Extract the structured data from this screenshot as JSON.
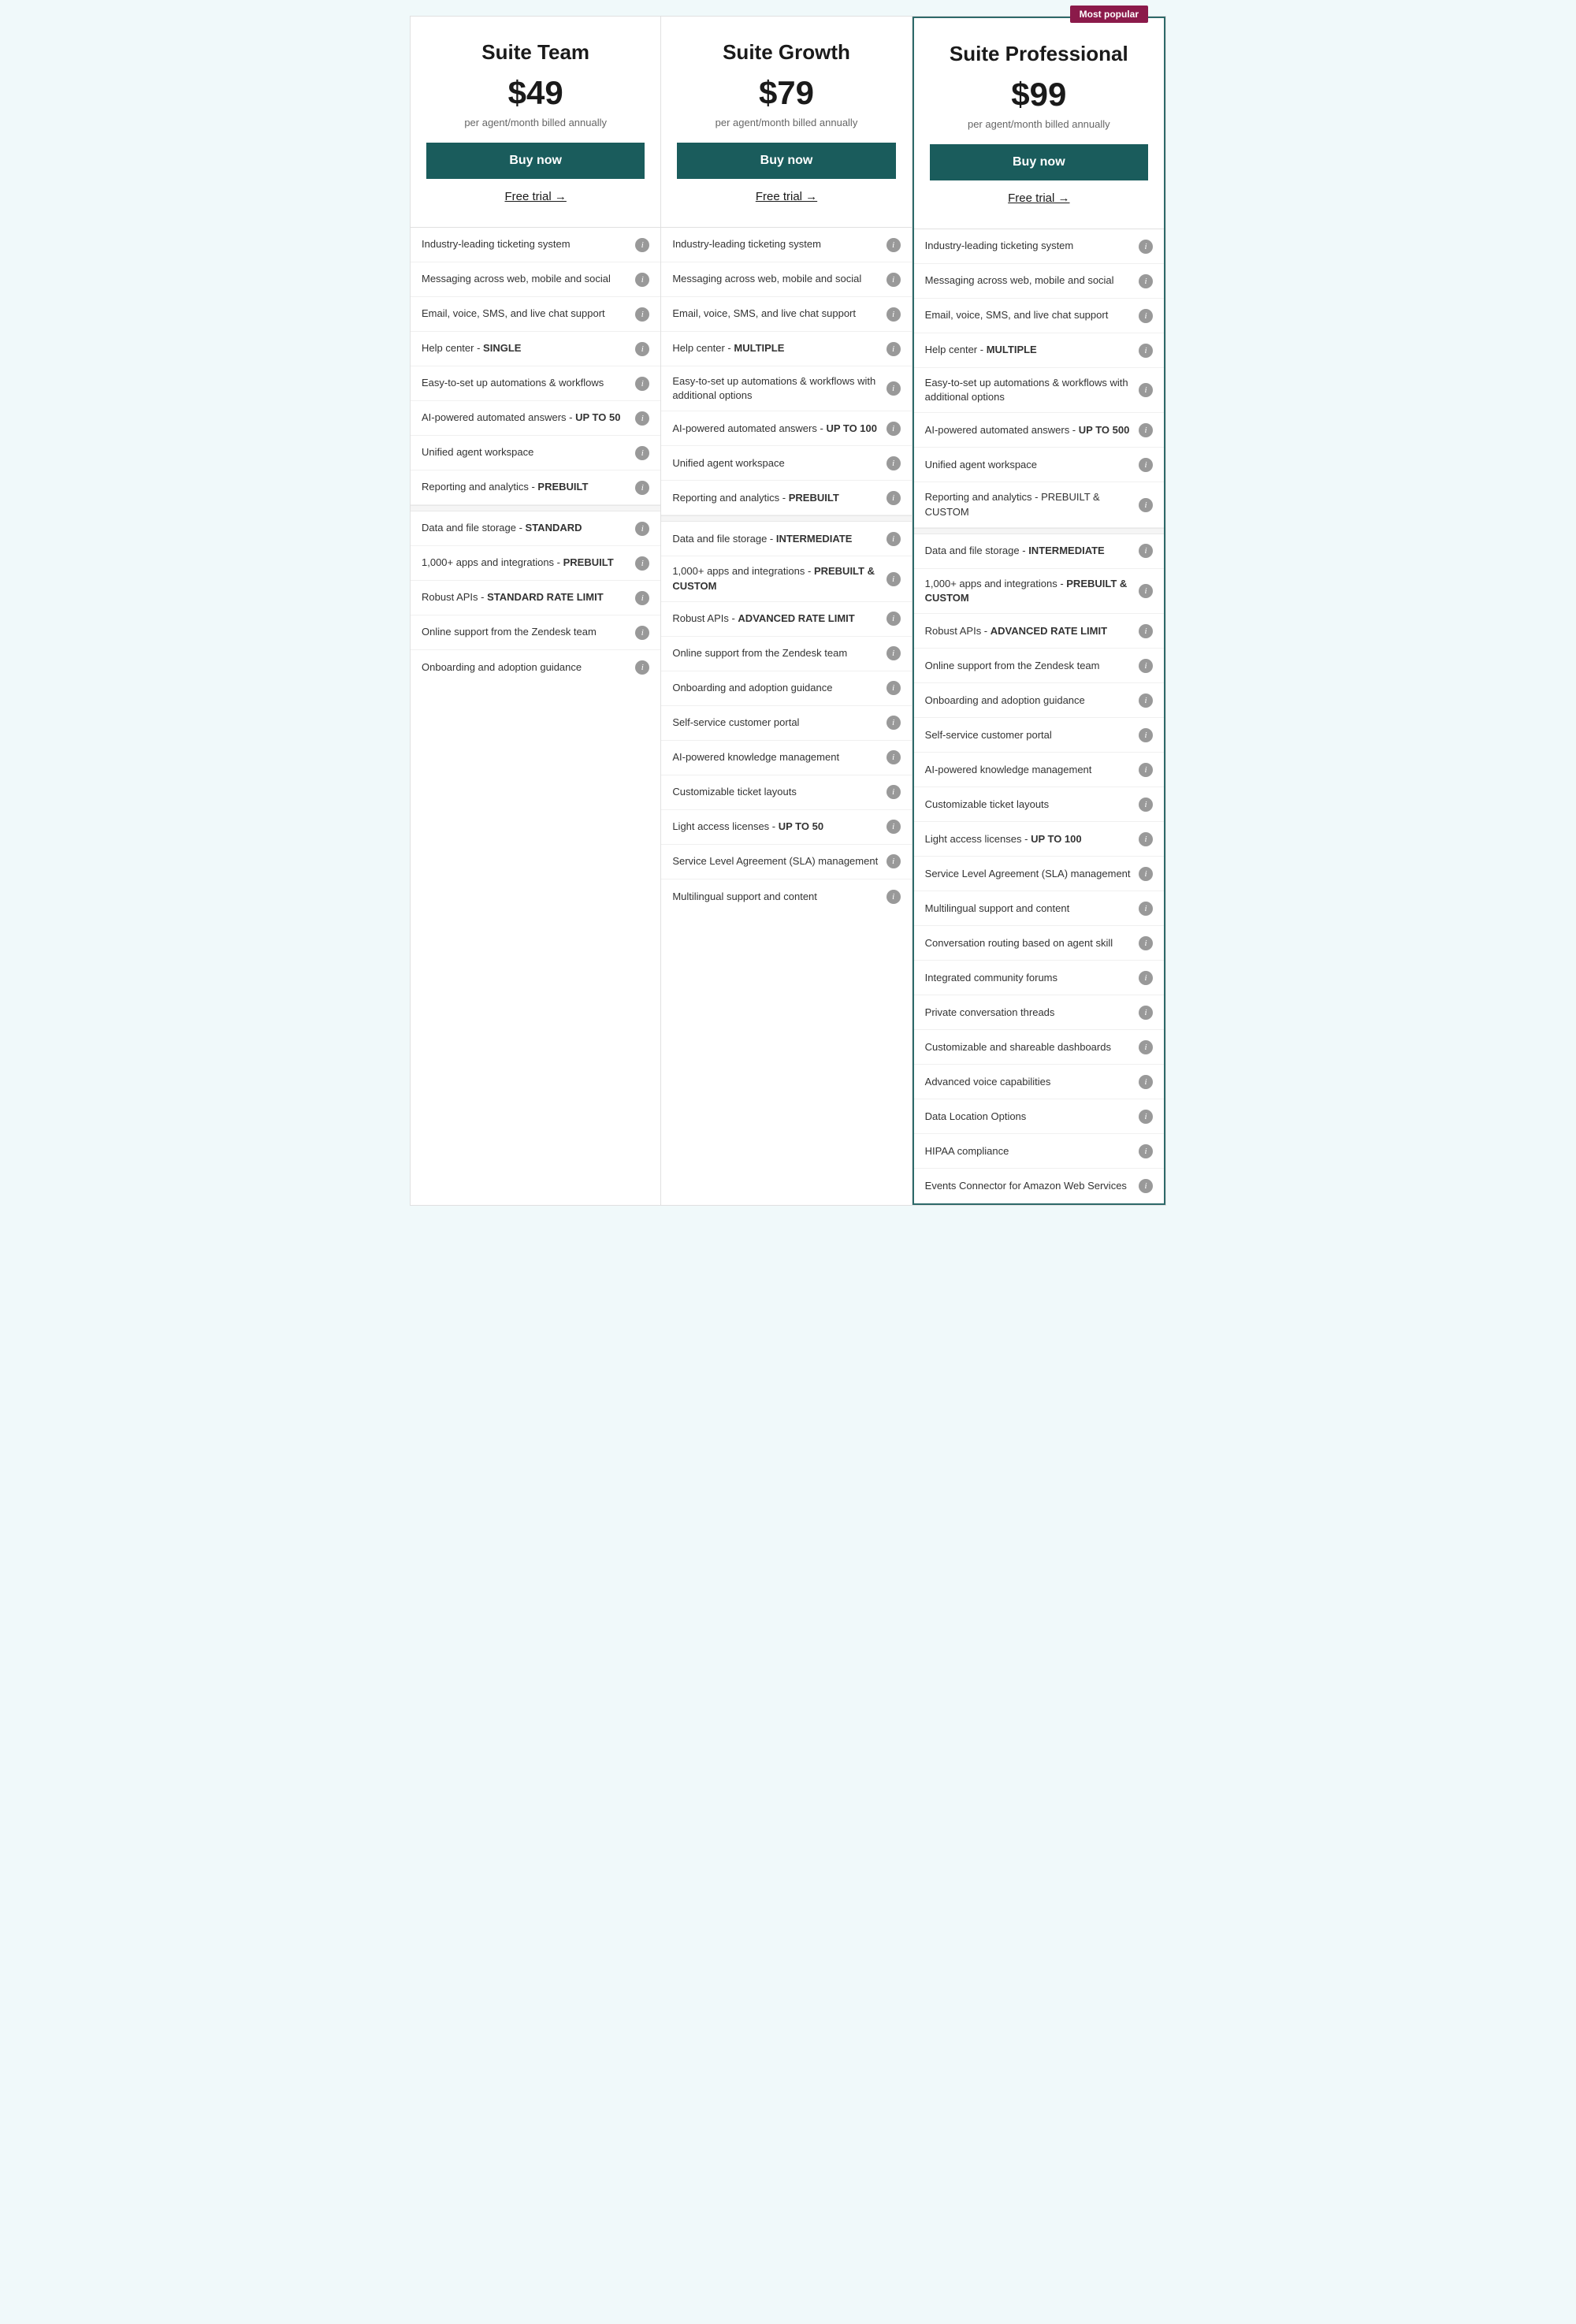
{
  "plans": [
    {
      "id": "suite-team",
      "name": "Suite Team",
      "price": "$49",
      "billing": "per agent/month billed annually",
      "buy_label": "Buy now",
      "free_trial_label": "Free trial →",
      "most_popular": false,
      "features": [
        {
          "text": "Industry-leading ticketing system",
          "bold": ""
        },
        {
          "text": "Messaging across web, mobile and social",
          "bold": ""
        },
        {
          "text": "Email, voice, SMS, and live chat support",
          "bold": ""
        },
        {
          "text": "Help center - ",
          "bold": "SINGLE"
        },
        {
          "text": "Easy-to-set up automations & workflows",
          "bold": ""
        },
        {
          "text": "AI-powered automated answers - ",
          "bold": "UP TO 50"
        },
        {
          "text": "Unified agent workspace",
          "bold": ""
        },
        {
          "text": "Reporting and analytics - ",
          "bold": "PREBUILT"
        },
        {
          "text": "DIVIDER",
          "bold": ""
        },
        {
          "text": "Data and file storage - ",
          "bold": "STANDARD"
        },
        {
          "text": "1,000+ apps and integrations - ",
          "bold": "PREBUILT"
        },
        {
          "text": "Robust APIs - ",
          "bold": "STANDARD RATE LIMIT"
        },
        {
          "text": "Online support from the Zendesk team",
          "bold": ""
        },
        {
          "text": "Onboarding and adoption guidance",
          "bold": ""
        }
      ]
    },
    {
      "id": "suite-growth",
      "name": "Suite Growth",
      "price": "$79",
      "billing": "per agent/month billed annually",
      "buy_label": "Buy now",
      "free_trial_label": "Free trial →",
      "most_popular": false,
      "features": [
        {
          "text": "Industry-leading ticketing system",
          "bold": ""
        },
        {
          "text": "Messaging across web, mobile and social",
          "bold": ""
        },
        {
          "text": "Email, voice, SMS, and live chat support",
          "bold": ""
        },
        {
          "text": "Help center - ",
          "bold": "MULTIPLE"
        },
        {
          "text": "Easy-to-set up automations & workflows with additional options",
          "bold": ""
        },
        {
          "text": "AI-powered automated answers - ",
          "bold": "UP TO 100"
        },
        {
          "text": "Unified agent workspace",
          "bold": ""
        },
        {
          "text": "Reporting and analytics - ",
          "bold": "PREBUILT"
        },
        {
          "text": "DIVIDER",
          "bold": ""
        },
        {
          "text": "Data and file storage - ",
          "bold": "INTERMEDIATE"
        },
        {
          "text": "1,000+ apps and integrations - ",
          "bold": "PREBUILT & CUSTOM"
        },
        {
          "text": "Robust APIs - ",
          "bold": "ADVANCED RATE LIMIT"
        },
        {
          "text": "Online support from the Zendesk team",
          "bold": ""
        },
        {
          "text": "Onboarding and adoption guidance",
          "bold": ""
        },
        {
          "text": "Self-service customer portal",
          "bold": ""
        },
        {
          "text": "AI-powered knowledge management",
          "bold": ""
        },
        {
          "text": "Customizable ticket layouts",
          "bold": ""
        },
        {
          "text": "Light access licenses - ",
          "bold": "UP TO 50"
        },
        {
          "text": "Service Level Agreement (SLA) management",
          "bold": ""
        },
        {
          "text": "Multilingual support and content",
          "bold": ""
        }
      ]
    },
    {
      "id": "suite-professional",
      "name": "Suite Professional",
      "price": "$99",
      "billing": "per agent/month billed annually",
      "buy_label": "Buy now",
      "free_trial_label": "Free trial →",
      "most_popular": true,
      "most_popular_label": "Most popular",
      "features": [
        {
          "text": "Industry-leading ticketing system",
          "bold": ""
        },
        {
          "text": "Messaging across web, mobile and social",
          "bold": ""
        },
        {
          "text": "Email, voice, SMS, and live chat support",
          "bold": ""
        },
        {
          "text": "Help center - ",
          "bold": "MULTIPLE"
        },
        {
          "text": "Easy-to-set up automations & workflows with additional options",
          "bold": ""
        },
        {
          "text": "AI-powered automated answers - ",
          "bold": "UP TO 500"
        },
        {
          "text": "Unified agent workspace",
          "bold": ""
        },
        {
          "text": "Reporting and analytics - PREBUILT & CUSTOM",
          "bold": ""
        },
        {
          "text": "DIVIDER",
          "bold": ""
        },
        {
          "text": "Data and file storage - ",
          "bold": "INTERMEDIATE"
        },
        {
          "text": "1,000+ apps and integrations - ",
          "bold": "PREBUILT & CUSTOM"
        },
        {
          "text": "Robust APIs - ",
          "bold": "ADVANCED RATE LIMIT"
        },
        {
          "text": "Online support from the Zendesk team",
          "bold": ""
        },
        {
          "text": "Onboarding and adoption guidance",
          "bold": ""
        },
        {
          "text": "Self-service customer portal",
          "bold": ""
        },
        {
          "text": "AI-powered knowledge management",
          "bold": ""
        },
        {
          "text": "Customizable ticket layouts",
          "bold": ""
        },
        {
          "text": "Light access licenses - ",
          "bold": "UP TO 100"
        },
        {
          "text": "Service Level Agreement (SLA) management",
          "bold": ""
        },
        {
          "text": "Multilingual support and content",
          "bold": ""
        },
        {
          "text": "Conversation routing based on agent skill",
          "bold": ""
        },
        {
          "text": "Integrated community forums",
          "bold": ""
        },
        {
          "text": "Private conversation threads",
          "bold": ""
        },
        {
          "text": "Customizable and shareable dashboards",
          "bold": ""
        },
        {
          "text": "Advanced voice capabilities",
          "bold": ""
        },
        {
          "text": "Data Location Options",
          "bold": ""
        },
        {
          "text": "HIPAA compliance",
          "bold": ""
        },
        {
          "text": "Events Connector for Amazon Web Services",
          "bold": ""
        }
      ]
    }
  ],
  "info_icon_label": "i"
}
